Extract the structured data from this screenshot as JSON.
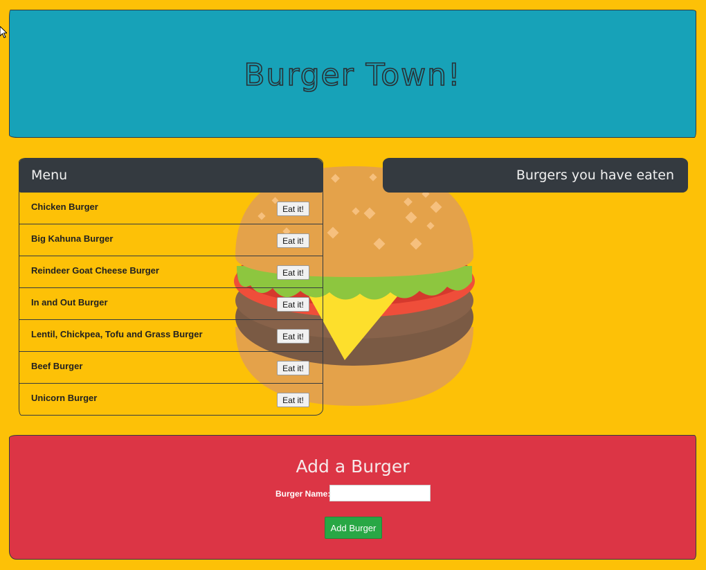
{
  "header": {
    "title": "Burger Town!"
  },
  "menu": {
    "title": "Menu",
    "button_label": "Eat it!",
    "items": [
      {
        "name": "Chicken Burger",
        "button": "Eat it!"
      },
      {
        "name": "Big Kahuna Burger",
        "button": "Eat it!"
      },
      {
        "name": "Reindeer Goat Cheese Burger",
        "button": "Eat it!"
      },
      {
        "name": "In and Out Burger",
        "button": "Eat it!"
      },
      {
        "name": "Lentil, Chickpea, Tofu and Grass Burger",
        "button": "Eat it!"
      },
      {
        "name": "Beef Burger",
        "button": "Eat it!"
      },
      {
        "name": "Unicorn Burger",
        "button": "Eat it!"
      }
    ]
  },
  "eaten": {
    "title": "Burgers you have eaten",
    "items": []
  },
  "add_form": {
    "title": "Add a Burger",
    "label": "Burger Name:",
    "input_value": "",
    "input_placeholder": "",
    "submit_label": "Add Burger"
  },
  "colors": {
    "page_background": "#fdc107",
    "header_background": "#17a2b8",
    "panel_header": "#343a40",
    "add_panel_background": "#dc3545",
    "add_button": "#28a745"
  },
  "icons": {
    "background_illustration": "hamburger-illustration",
    "cursor": "mouse-pointer-icon"
  }
}
